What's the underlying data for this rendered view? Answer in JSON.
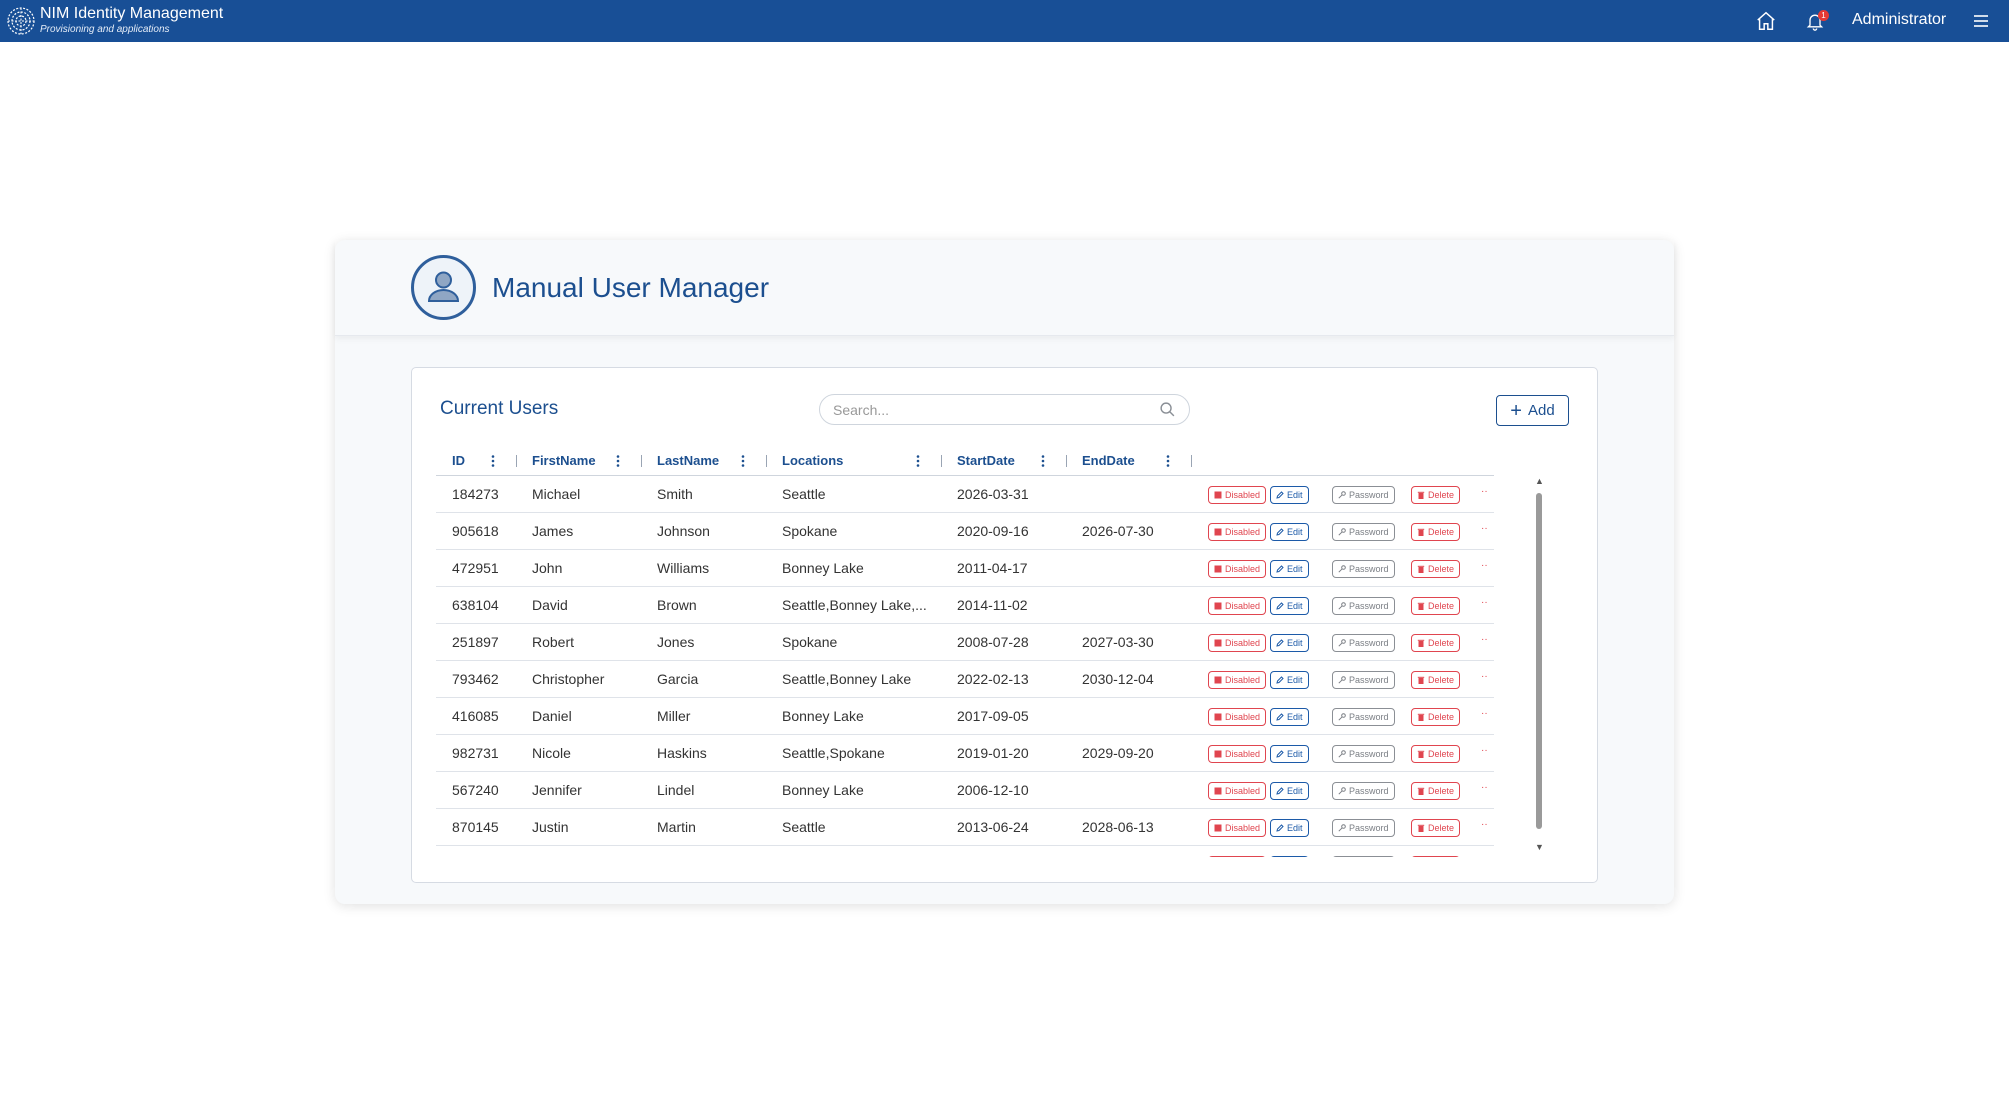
{
  "app": {
    "title": "NIM Identity Management",
    "subtitle": "Provisioning and applications",
    "user": "Administrator",
    "notification_count": "1",
    "brand_color": "#184f96"
  },
  "page": {
    "title": "Manual User Manager"
  },
  "panel": {
    "title": "Current Users",
    "search_placeholder": "Search...",
    "add_label": "Add"
  },
  "table": {
    "columns": [
      "ID",
      "FirstName",
      "LastName",
      "Locations",
      "StartDate",
      "EndDate"
    ],
    "actions": {
      "disabled": "Disabled",
      "edit": "Edit",
      "password": "Password",
      "delete": "Delete"
    },
    "rows": [
      {
        "id": "184273",
        "first": "Michael",
        "last": "Smith",
        "locations": "Seattle",
        "start": "2026-03-31",
        "end": ""
      },
      {
        "id": "905618",
        "first": "James",
        "last": "Johnson",
        "locations": "Spokane",
        "start": "2020-09-16",
        "end": "2026-07-30"
      },
      {
        "id": "472951",
        "first": "John",
        "last": "Williams",
        "locations": "Bonney Lake",
        "start": "2011-04-17",
        "end": ""
      },
      {
        "id": "638104",
        "first": "David",
        "last": "Brown",
        "locations": "Seattle,Bonney Lake,...",
        "start": "2014-11-02",
        "end": ""
      },
      {
        "id": "251897",
        "first": "Robert",
        "last": "Jones",
        "locations": "Spokane",
        "start": "2008-07-28",
        "end": "2027-03-30"
      },
      {
        "id": "793462",
        "first": "Christopher",
        "last": "Garcia",
        "locations": "Seattle,Bonney Lake",
        "start": "2022-02-13",
        "end": "2030-12-04"
      },
      {
        "id": "416085",
        "first": "Daniel",
        "last": "Miller",
        "locations": "Bonney Lake",
        "start": "2017-09-05",
        "end": ""
      },
      {
        "id": "982731",
        "first": "Nicole",
        "last": "Haskins",
        "locations": "Seattle,Spokane",
        "start": "2019-01-20",
        "end": "2029-09-20"
      },
      {
        "id": "567240",
        "first": "Jennifer",
        "last": "Lindel",
        "locations": "Bonney Lake",
        "start": "2006-12-10",
        "end": ""
      },
      {
        "id": "870145",
        "first": "Justin",
        "last": "Martin",
        "locations": "Seattle",
        "start": "2013-06-24",
        "end": "2028-06-13"
      },
      {
        "id": "",
        "first": "",
        "last": "",
        "locations": "",
        "start": "",
        "end": ""
      }
    ]
  }
}
